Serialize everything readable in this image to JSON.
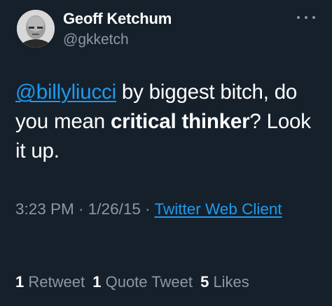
{
  "author": {
    "display_name": "Geoff Ketchum",
    "handle": "@gkketch",
    "avatar_icon": "profile-photo"
  },
  "more_icon": "ellipsis-icon",
  "tweet": {
    "mention": "@billyliucci",
    "part1": " by biggest bitch, do you mean ",
    "bold1": "critical thinker",
    "part2": "? Look it up."
  },
  "meta": {
    "time": "3:23 PM",
    "separator1": " · ",
    "date": "1/26/15",
    "separator2": " · ",
    "source": "Twitter Web Client"
  },
  "stats": {
    "retweets_count": "1",
    "retweets_label": "Retweet",
    "quotes_count": "1",
    "quotes_label": "Quote Tweet",
    "likes_count": "5",
    "likes_label": "Likes"
  },
  "colors": {
    "background": "#15202b",
    "link": "#1d9bf0",
    "secondary_text": "#8b98a5",
    "primary_text": "#ffffff"
  }
}
